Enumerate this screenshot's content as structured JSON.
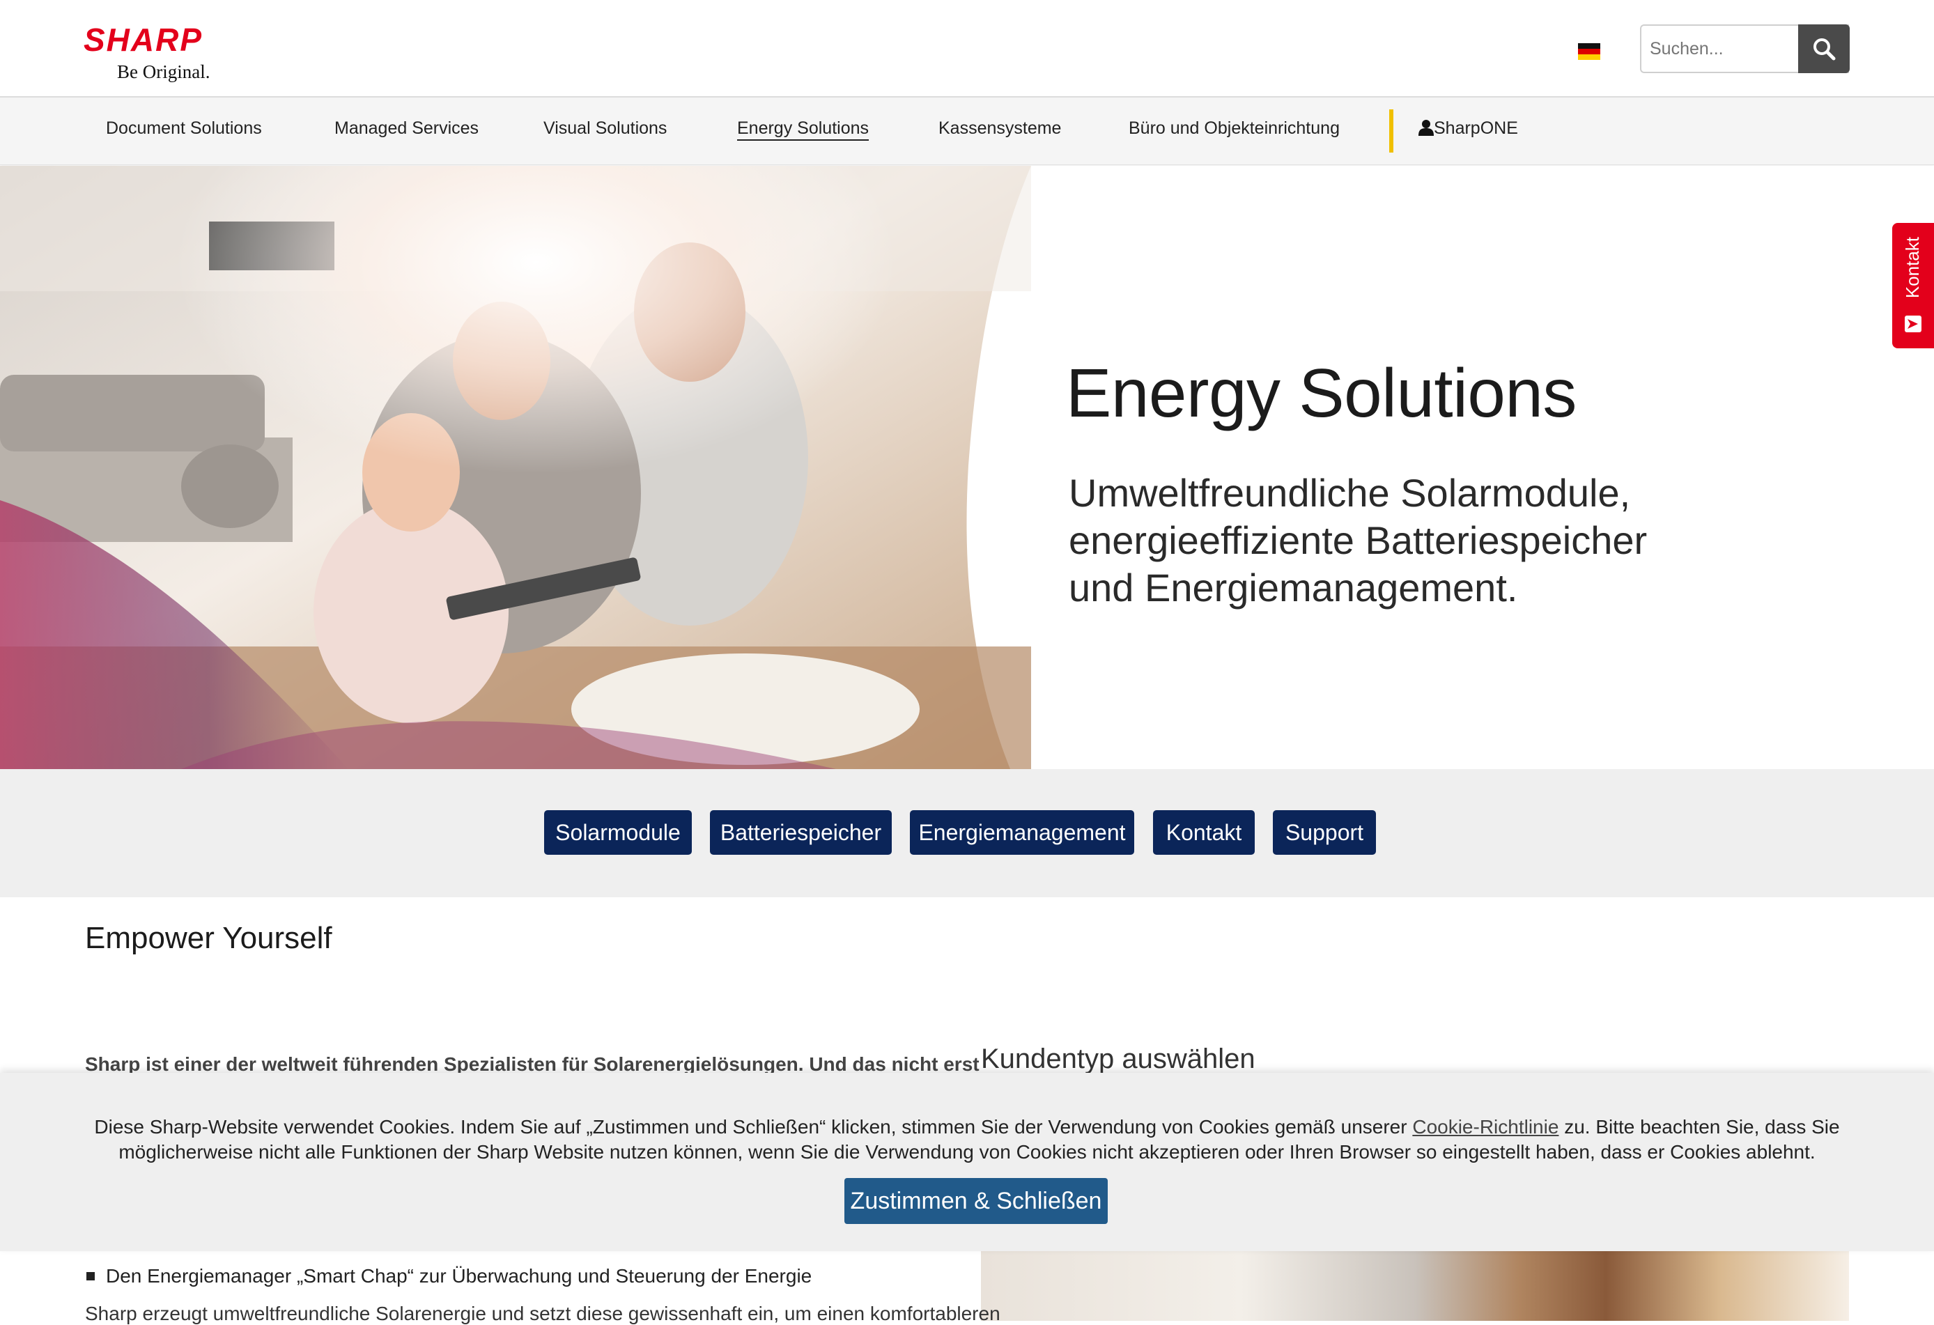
{
  "header": {
    "logo_word": "SHARP",
    "logo_tagline": "Be Original.",
    "language_flag": "flag-germany",
    "search_placeholder": "Suchen...",
    "search_icon": "search-icon"
  },
  "nav": {
    "items": [
      {
        "label": "Document Solutions"
      },
      {
        "label": "Managed Services"
      },
      {
        "label": "Visual Solutions"
      },
      {
        "label": "Energy Solutions",
        "active": true
      },
      {
        "label": "Kassensysteme"
      },
      {
        "label": "Büro und Objekteinrichtung"
      }
    ],
    "account_label": "SharpONE",
    "account_icon": "user-icon"
  },
  "hero": {
    "title": "Energy Solutions",
    "subtitle_lines": [
      "Umweltfreundliche Solarmodule,",
      "energieeffiziente Batteriespeicher",
      "und Energiemanagement."
    ],
    "side_tab": "Kontakt",
    "side_tab_icon": "mail-icon"
  },
  "buttons": [
    {
      "label": "Solarmodule"
    },
    {
      "label": "Batteriespeicher"
    },
    {
      "label": "Energiemanagement"
    },
    {
      "label": "Kontakt"
    },
    {
      "label": "Support"
    }
  ],
  "content": {
    "heading": "Empower Yourself",
    "intro_partial": "Sharp ist einer der weltweit führenden Spezialisten für Solarenergielösungen. Und das nicht erst",
    "kundentyp_heading": "Kundentyp auswählen",
    "bullet": "Den Energiemanager „Smart Chap“ zur Überwachung und Steuerung der Energie",
    "para_partial": "Sharp erzeugt umweltfreundliche Solarenergie und setzt diese gewissenhaft ein, um einen komfortableren"
  },
  "cookie": {
    "text_before_link": "Diese Sharp-Website verwendet Cookies. Indem Sie auf „Zustimmen und Schließen“ klicken, stimmen Sie der Verwendung von Cookies gemäß unserer ",
    "link": "Cookie-Richtlinie",
    "text_after_link": " zu. Bitte beachten Sie, dass Sie möglicherweise nicht alle Funktionen der Sharp Website nutzen können, wenn Sie die Verwendung von Cookies nicht akzeptieren oder Ihren Browser so eingestellt haben, dass er Cookies ablehnt.",
    "button": "Zustimmen & Schließen"
  },
  "colors": {
    "brand_red": "#e3001b",
    "button_navy": "#0b2559",
    "cookie_button": "#215a8a",
    "nav_separator": "#f0c000"
  }
}
